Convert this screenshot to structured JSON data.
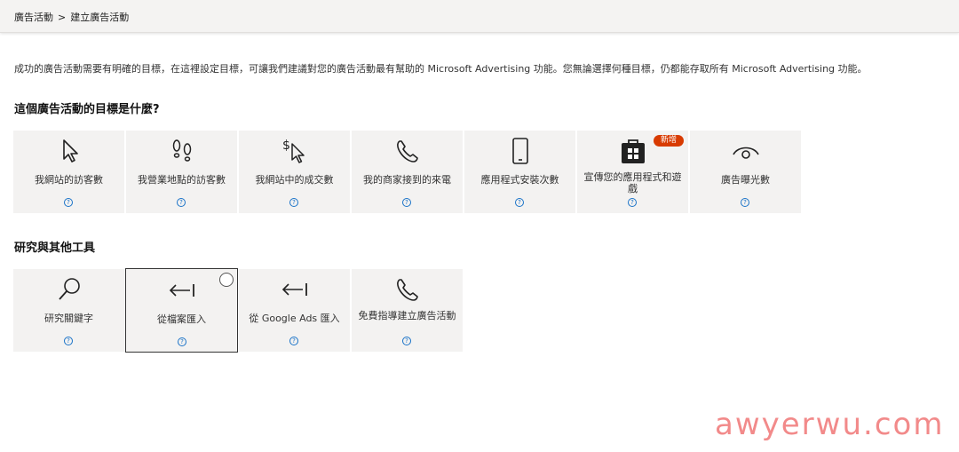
{
  "breadcrumb": {
    "root": "廣告活動",
    "separator": ">",
    "current": "建立廣告活動"
  },
  "intro": "成功的廣告活動需要有明確的目標，在這裡設定目標，可讓我們建議對您的廣告活動最有幫助的 Microsoft Advertising 功能。您無論選擇何種目標，仍都能存取所有 Microsoft Advertising 功能。",
  "goals": {
    "title": "這個廣告活動的目標是什麼?",
    "tiles": [
      {
        "label": "我網站的訪客數",
        "icon": "cursor-icon"
      },
      {
        "label": "我營業地點的訪客數",
        "icon": "footprints-icon"
      },
      {
        "label": "我網站中的成交數",
        "icon": "dollar-cursor-icon"
      },
      {
        "label": "我的商家接到的來電",
        "icon": "phone-icon"
      },
      {
        "label": "應用程式安裝次數",
        "icon": "mobile-icon"
      },
      {
        "label": "宣傳您的應用程式和遊戲",
        "icon": "store-icon",
        "badge": "新增"
      },
      {
        "label": "廣告曝光數",
        "icon": "eye-icon"
      }
    ]
  },
  "tools": {
    "title": "研究與其他工具",
    "tiles": [
      {
        "label": "研究關鍵字",
        "icon": "search-icon"
      },
      {
        "label": "從檔案匯入",
        "icon": "import-arrow-icon",
        "selected": true
      },
      {
        "label": "從 Google Ads 匯入",
        "icon": "import-arrow-icon"
      },
      {
        "label": "免費指導建立廣告活動",
        "icon": "phone-icon"
      }
    ]
  },
  "help_glyph": "?",
  "watermark": "awyerwu.com"
}
